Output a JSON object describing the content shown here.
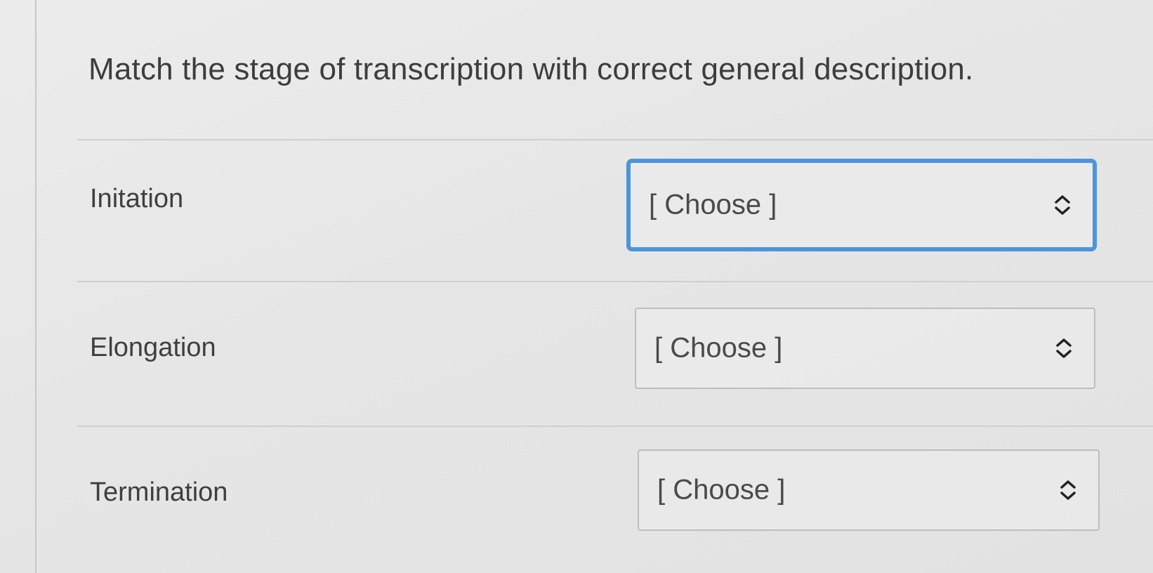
{
  "question": {
    "title": "Match the stage of transcription with correct general description."
  },
  "rows": [
    {
      "label": "Initation",
      "select_value": "[ Choose ]"
    },
    {
      "label": "Elongation",
      "select_value": "[ Choose ]"
    },
    {
      "label": "Termination",
      "select_value": "[ Choose ]"
    }
  ],
  "colors": {
    "focus_border": "#4d94dc",
    "text": "#3d3d3d",
    "divider": "#cfcfcf"
  }
}
